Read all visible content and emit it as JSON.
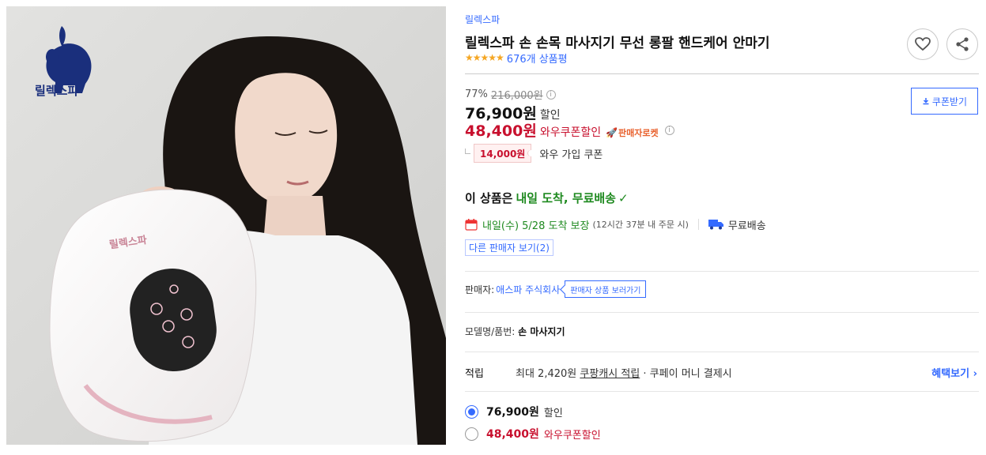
{
  "image": {
    "logo_text": "릴렉스파",
    "device_logo_text": "릴렉스파"
  },
  "product": {
    "brand": "릴렉스파",
    "title": "릴렉스파 손 손목 마사지기 무선 롱팔 핸드케어 안마기",
    "stars": "★★★★★",
    "review_count": "676개 상품평"
  },
  "actions": {
    "heart_icon": "heart-icon",
    "share_icon": "share-icon",
    "coupon_button": "쿠폰받기"
  },
  "pricing": {
    "discount_rate": "77%",
    "original_price": "216,000원",
    "sale_price": "76,900원",
    "sale_label": "할인",
    "wow_price": "48,400원",
    "wow_label": "와우쿠폰할인",
    "rocket_badge": "판매자로켓",
    "coupon_amount": "14,000원",
    "coupon_desc": "와우 가입 쿠폰"
  },
  "delivery": {
    "head_prefix": "이 상품은",
    "head_highlight": "내일 도착, 무료배송",
    "arrive": "내일(수) 5/28 도착 보장",
    "arrive_detail": "(12시간 37분 내 주문 시)",
    "free_shipping": "무료배송",
    "other_sellers": "다른 판매자 보기(2)"
  },
  "seller": {
    "label": "판매자:",
    "name": "애스파 주식회사",
    "link": "판매자 상품 보러가기"
  },
  "model": {
    "label": "모델명/품번:",
    "value": "손 마사지기"
  },
  "reward": {
    "label": "적립",
    "prefix": "최대 2,420원",
    "link": "쿠팡캐시 적립",
    "suffix": "· 쿠페이 머니 결제시",
    "benefit": "혜택보기 ›"
  },
  "options": [
    {
      "price": "76,900원",
      "label": "할인",
      "selected": true
    },
    {
      "price": "48,400원",
      "label": "와우쿠폰할인",
      "selected": false
    }
  ],
  "colors": {
    "accent": "#346aff",
    "price_red": "#c8102e",
    "delivery_green": "#1f8a20"
  }
}
